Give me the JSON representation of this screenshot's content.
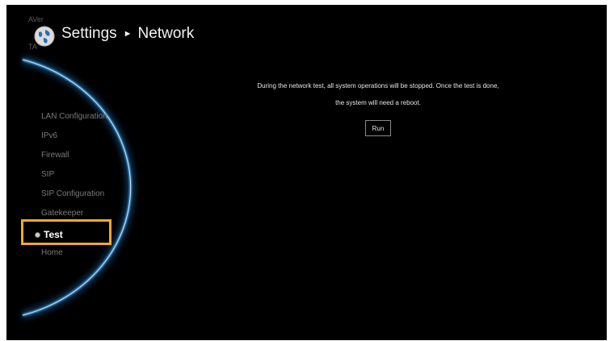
{
  "brand": {
    "name": "AVer",
    "sub": "TA"
  },
  "header": {
    "icon": "globe-icon",
    "title": "Settings",
    "separator": "►",
    "section": "Network"
  },
  "sidebar": {
    "items": [
      {
        "label": "LAN Configuration",
        "active": false
      },
      {
        "label": "IPv6",
        "active": false
      },
      {
        "label": "Firewall",
        "active": false
      },
      {
        "label": "SIP",
        "active": false
      },
      {
        "label": "SIP Configuration",
        "active": false
      },
      {
        "label": "Gatekeeper",
        "active": false
      },
      {
        "label": "Test",
        "active": true
      },
      {
        "label": "Home",
        "active": false
      }
    ]
  },
  "main": {
    "message_line1": "During the network test, all system operations will be stopped. Once the test is done,",
    "message_line2": "the system will need a reboot.",
    "run_label": "Run"
  },
  "colors": {
    "background": "#000000",
    "highlight": "#f0a830",
    "arc_glow": "#4aa8e8"
  }
}
